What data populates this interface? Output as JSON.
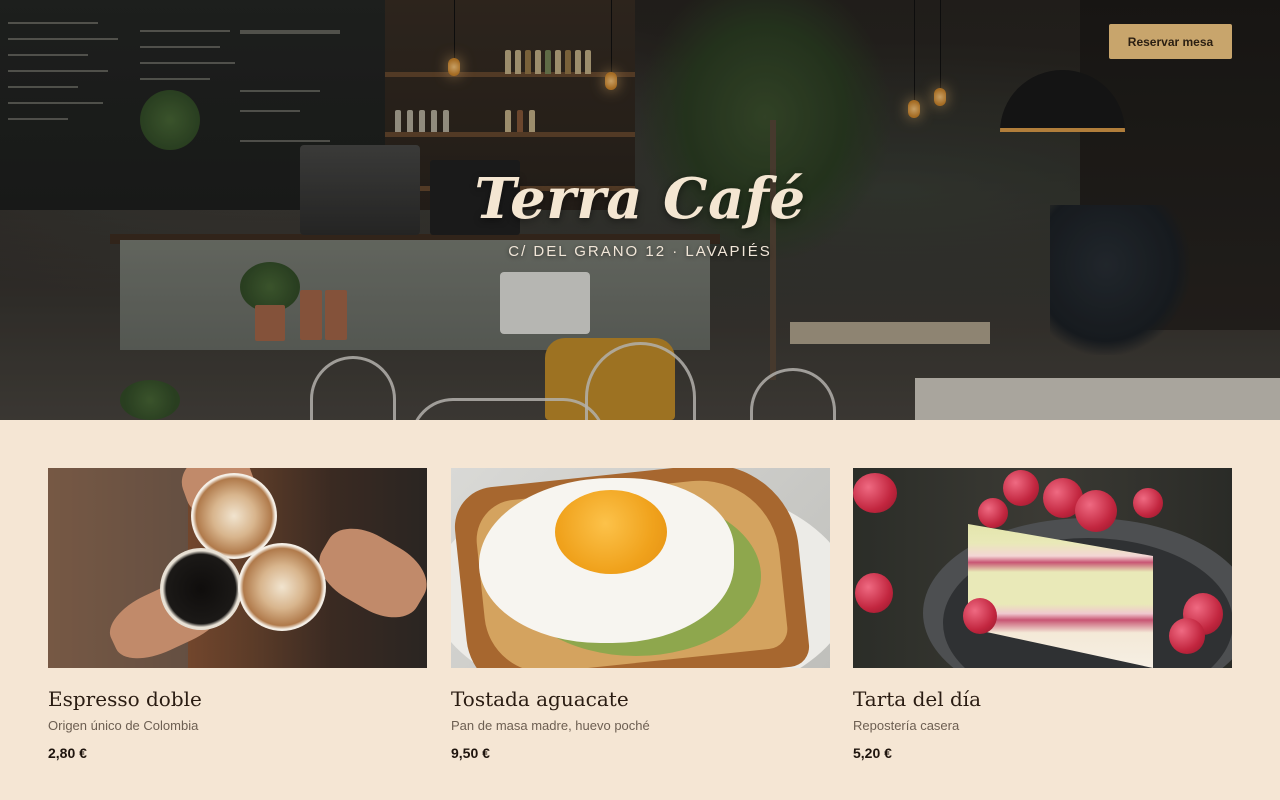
{
  "header": {
    "reserve_label": "Reservar mesa"
  },
  "hero": {
    "title": "Terra Café",
    "address": "C/ DEL GRANO 12 · LAVAPIÉS"
  },
  "menu": {
    "items": [
      {
        "name": "Espresso doble",
        "description": "Origen único de Colombia",
        "price": "2,80 €"
      },
      {
        "name": "Tostada aguacate",
        "description": "Pan de masa madre, huevo poché",
        "price": "9,50 €"
      },
      {
        "name": "Tarta del día",
        "description": "Repostería casera",
        "price": "5,20 €"
      }
    ]
  },
  "colors": {
    "background": "#f5e6d4",
    "accent": "#c8a56c",
    "title_text": "#f4e6d2",
    "heading_text": "#2a1c12"
  }
}
